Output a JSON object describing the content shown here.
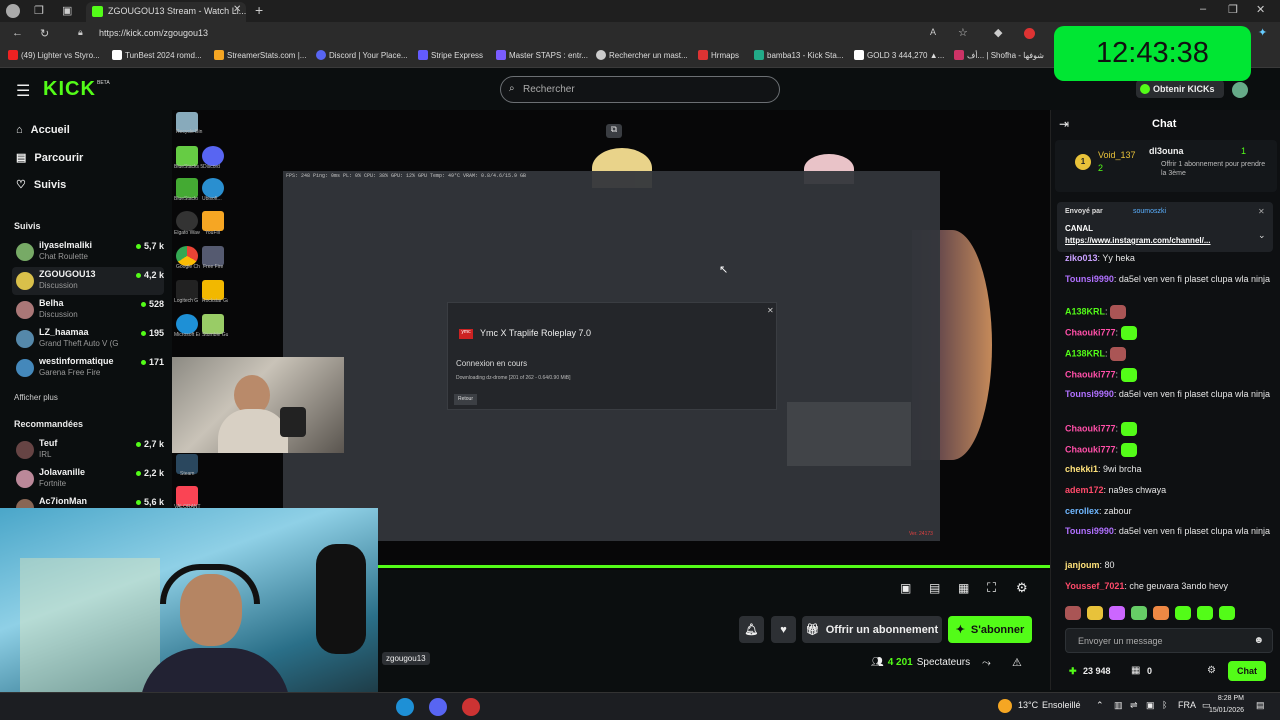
{
  "browser": {
    "tab_title": "ZGOUGOU13 Stream - Watch Li...",
    "url": "https://kick.com/zgougou13",
    "bookmarks": [
      "(49) Lighter vs Styro...",
      "TunBest 2024 romd...",
      "StreamerStats.com |...",
      "Discord | Your Place...",
      "Stripe Express",
      "Master STAPS : entr...",
      "Rechercher un mast...",
      "Hrmaps",
      "bamba13 - Kick Sta...",
      "GOLD 3 444,270 ▲...",
      "أف... | Shofha - شوفها"
    ]
  },
  "clock": "12:43:38",
  "header": {
    "logo": "KICK",
    "beta": "BETA",
    "search_placeholder": "Rechercher",
    "kicks_button": "Obtenir KICKs"
  },
  "sidebar": {
    "nav": [
      "Accueil",
      "Parcourir",
      "Suivis"
    ],
    "followed_title": "Suivis",
    "followed": [
      {
        "name": "ilyaselmaliki",
        "category": "Chat Roulette",
        "viewers": "5,7 k"
      },
      {
        "name": "ZGOUGOU13",
        "category": "Discussion",
        "viewers": "4,2 k"
      },
      {
        "name": "Belha",
        "category": "Discussion",
        "viewers": "528"
      },
      {
        "name": "LZ_haamaa",
        "category": "Grand Theft Auto V (G...",
        "viewers": "195"
      },
      {
        "name": "westinformatique",
        "category": "Garena Free Fire",
        "viewers": "171"
      }
    ],
    "show_more": "Afficher plus",
    "recommended_title": "Recommandées",
    "recommended": [
      {
        "name": "Teuf",
        "category": "IRL",
        "viewers": "2,7 k"
      },
      {
        "name": "Jolavanille",
        "category": "Fortnite",
        "viewers": "2,2 k"
      },
      {
        "name": "Ac7ionMan",
        "category": "",
        "viewers": "5,6 k"
      }
    ]
  },
  "game": {
    "stats": "FPS: 248    Ping: 0ms    PL: 0%    CPU: 38%    GPU: 12%    GPU Temp: 49°C    VRAM: 0.8/4.6/15.9 GB",
    "dialog_title": "Ymc X Traplife Roleplay 7.0",
    "dialog_status": "Connexion en cours",
    "dialog_detail": "Downloading dz-drome [201 of 262 - 0.64/0.90 MiB]",
    "dialog_button": "Retour",
    "version": "Ver. 24173",
    "desktop_icons": [
      "Recycle Bin",
      "BlueStacks 5",
      "Discord",
      "BlueStacks Multi-Insta...",
      "Ubisoft...",
      "Elgato Wave Link",
      "YouFill",
      "Google Chrome",
      "Free Fire",
      "Logitech G HUB",
      "Rockstar Games...",
      "Microsoft Edge",
      "Stumble Guys",
      "Steam",
      "VALORANT"
    ]
  },
  "streamer": {
    "username": "zgougou13",
    "subscribe_offer": "Offrir un abonnement",
    "subscribe": "S'abonner",
    "viewers": "4 201",
    "viewers_label": "Spectateurs"
  },
  "chat": {
    "title": "Chat",
    "leader": {
      "name": "Void_137",
      "count": "2",
      "rank": "1"
    },
    "gift": {
      "name": "dl3ouna",
      "count": "1",
      "text": "Offrir 1 abonnement pour prendre la 3ème"
    },
    "pinned_by_label": "Envoyé par",
    "pinned_by": "soumoszki",
    "pinned_title": "CANAL",
    "pinned_link": "https://www.instagram.com/channel/...",
    "messages": [
      {
        "user": "ziko013",
        "color": "#c9a0ff",
        "text": "Yy hekа"
      },
      {
        "user": "Tounsi9990",
        "color": "#b070ff",
        "text": "da5el ven ven fi plaset clupa wla ninja"
      },
      {
        "user": "A138KRL",
        "color": "#53fc18",
        "text": ""
      },
      {
        "user": "Chaouki777",
        "color": "#ff4fa8",
        "text": ""
      },
      {
        "user": "A138KRL",
        "color": "#53fc18",
        "text": ""
      },
      {
        "user": "Chaouki777",
        "color": "#ff4fa8",
        "text": ""
      },
      {
        "user": "Tounsi9990",
        "color": "#b070ff",
        "text": "da5el ven ven fi plaset clupa wla ninja"
      },
      {
        "user": "Chaouki777",
        "color": "#ff4fa8",
        "text": ""
      },
      {
        "user": "Chaouki777",
        "color": "#ff4fa8",
        "text": ""
      },
      {
        "user": "chekki1",
        "color": "#ffe27a",
        "text": "9wi brcha"
      },
      {
        "user": "adem172",
        "color": "#ff4a6a",
        "text": "na9es chwaya"
      },
      {
        "user": "cerollex",
        "color": "#6fb7ff",
        "text": "zabour"
      },
      {
        "user": "Tounsi9990",
        "color": "#b070ff",
        "text": "da5el ven ven fi plaset clupa wla ninja"
      },
      {
        "user": "janjoum",
        "color": "#ffe27a",
        "text": "80"
      },
      {
        "user": "Youssef_7021",
        "color": "#ff4a6a",
        "text": "che geuvara 3ando hevy"
      }
    ],
    "input_placeholder": "Envoyer un message",
    "points": "23 948",
    "chest": "0",
    "send": "Chat"
  },
  "taskbar": {
    "temp": "13°C",
    "weather": "Ensoleillé",
    "lang": "FRA",
    "time": "8:28 PM",
    "date": "15/01/2026"
  }
}
